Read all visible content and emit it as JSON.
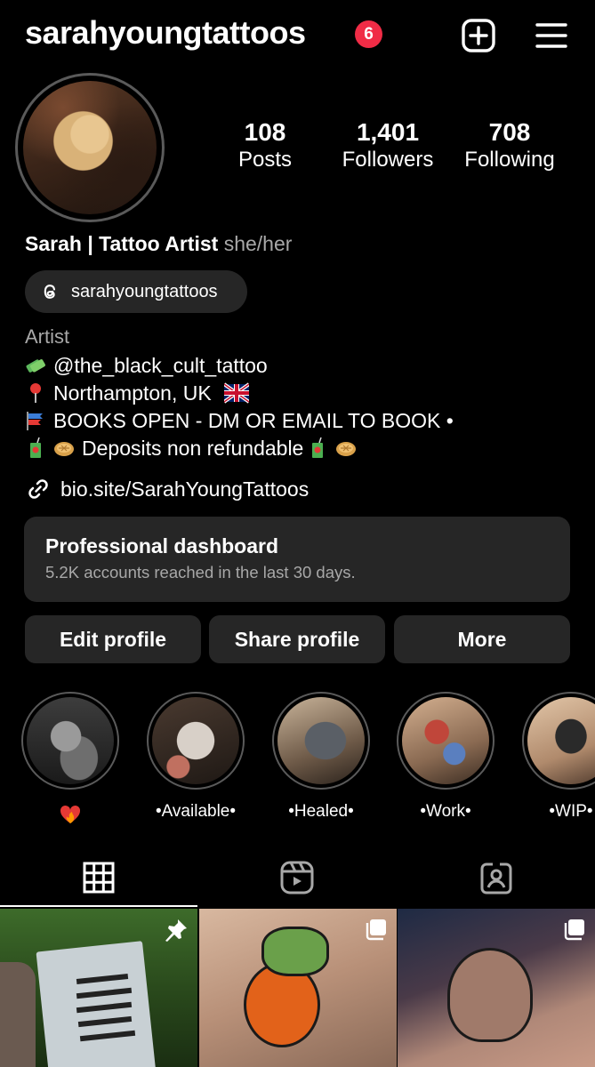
{
  "header": {
    "username": "sarahyoungtattoos",
    "notification_count": "6",
    "icons": [
      "add-post-icon",
      "menu-icon"
    ]
  },
  "stats": [
    {
      "value": "108",
      "label": "Posts"
    },
    {
      "value": "1,401",
      "label": "Followers"
    },
    {
      "value": "708",
      "label": "Following"
    }
  ],
  "bio": {
    "name": "Sarah | Tattoo Artist",
    "pronouns": "she/her",
    "threads_handle": "sarahyoungtattoos",
    "category": "Artist",
    "lines": [
      "@the_black_cult_tattoo",
      "Northampton, UK",
      "BOOKS OPEN - DM OR EMAIL TO BOOK •",
      "Deposits non refundable"
    ],
    "link": "bio.site/SarahYoungTattoos"
  },
  "dashboard": {
    "title": "Professional dashboard",
    "subtitle": "5.2K accounts reached in the last 30 days."
  },
  "buttons": {
    "edit": "Edit profile",
    "share": "Share profile",
    "more": "More"
  },
  "highlights": [
    {
      "label": ""
    },
    {
      "label": "•Available•"
    },
    {
      "label": "•Healed•"
    },
    {
      "label": "•Work•"
    },
    {
      "label": "•WIP•"
    }
  ],
  "tabs": [
    "grid-icon",
    "reels-icon",
    "tagged-icon"
  ],
  "colors": {
    "background": "#000000",
    "surface": "#262626",
    "badge": "#f02c46",
    "muted_text": "#a8a8a8"
  }
}
